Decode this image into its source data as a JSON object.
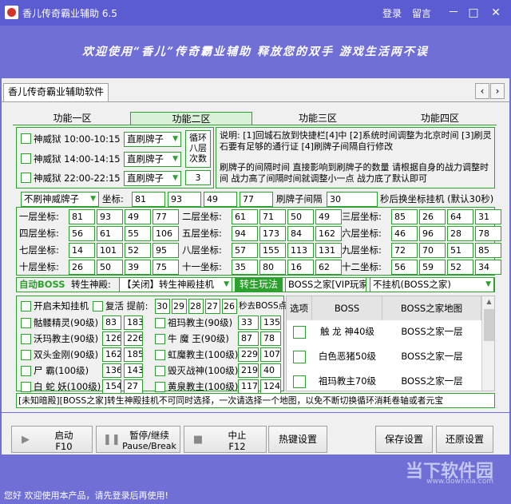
{
  "window": {
    "title": "香儿传奇霸业辅助 6.5",
    "login": "登录",
    "message": "留言",
    "minimize_glyph": "－",
    "restore_glyph": "□",
    "close_glyph": "✕"
  },
  "banner": {
    "slogan": "欢迎使用“香儿”传奇霸业辅助 释放您的双手 游戏生活两不误"
  },
  "main_tab": {
    "label": "香儿传奇霸业辅助软件",
    "prev": "‹",
    "next": "›"
  },
  "tabs": [
    "功能一区",
    "功能二区",
    "功能三区",
    "功能四区"
  ],
  "prison": {
    "rows": [
      {
        "label": "神威狱 10:00-10:15",
        "mode": "直刷牌子"
      },
      {
        "label": "神威狱 14:00-14:15",
        "mode": "直刷牌子"
      },
      {
        "label": "神威狱 22:00-22:15",
        "mode": "直刷牌子"
      }
    ],
    "loop_label": "循环八层次数",
    "loop_count": "3"
  },
  "notes": {
    "text1": "说明: [1]回城石放到快捷栏[4]中 [2]系统时间调整为北京时间 [3]刷灵石要有足够的通行证 [4]刷牌子间隔自行修改",
    "text2": "刷牌子的间隔时间 直接影响到刷牌子的数量 请根据自身的战力调整时间 战力高了间隔时间就调整小一点 战力底了默认即可"
  },
  "coord_row": {
    "token_select": "不刷神威牌子",
    "coord_label": "坐标:",
    "values": [
      "81",
      "93",
      "49",
      "77"
    ],
    "interval_label": "刷牌子间隔",
    "interval": "30",
    "interval_suffix": "秒后换坐标挂机 (默认30秒)"
  },
  "floors": [
    {
      "label": "一层坐标:",
      "v": [
        "81",
        "93",
        "49",
        "77"
      ]
    },
    {
      "label": "二层坐标:",
      "v": [
        "61",
        "71",
        "50",
        "49"
      ]
    },
    {
      "label": "三层坐标:",
      "v": [
        "85",
        "26",
        "64",
        "31"
      ]
    },
    {
      "label": "四层坐标:",
      "v": [
        "56",
        "61",
        "55",
        "106"
      ]
    },
    {
      "label": "五层坐标:",
      "v": [
        "94",
        "173",
        "84",
        "162"
      ]
    },
    {
      "label": "六层坐标:",
      "v": [
        "46",
        "96",
        "28",
        "78"
      ]
    },
    {
      "label": "七层坐标:",
      "v": [
        "14",
        "101",
        "52",
        "95"
      ]
    },
    {
      "label": "八层坐标:",
      "v": [
        "57",
        "155",
        "113",
        "131"
      ]
    },
    {
      "label": "九层坐标:",
      "v": [
        "72",
        "70",
        "51",
        "85"
      ]
    },
    {
      "label": "十层坐标:",
      "v": [
        "26",
        "50",
        "39",
        "75"
      ]
    },
    {
      "label": "十一坐标:",
      "v": [
        "35",
        "80",
        "16",
        "62"
      ]
    },
    {
      "label": "十二坐标:",
      "v": [
        "56",
        "59",
        "52",
        "34"
      ]
    }
  ],
  "boss_bar": {
    "title": "自动BOSS",
    "rebirth_label": "转生神殿:",
    "rebirth_select": "【关闭】转生神殿挂机",
    "play_btn": "转生玩法",
    "home_select": "BOSS之家[VIP玩家]",
    "hang_select": "不挂机(BOSS之家)"
  },
  "boss_left": {
    "unknown_label": "开启未知挂机",
    "revive_label": "复活 提前:",
    "times": [
      "30",
      "29",
      "28",
      "27",
      "26"
    ],
    "times_suffix": "秒去BOSS点",
    "rows": [
      {
        "a": "骷髅精灵(90级)",
        "a1": "83",
        "a2": "183",
        "b": "祖玛教主(90级)",
        "b1": "33",
        "b2": "135"
      },
      {
        "a": "沃玛教主(90级)",
        "a1": "126",
        "a2": "226",
        "b": "牛 魔 王(90级)",
        "b1": "87",
        "b2": "78"
      },
      {
        "a": "双头金刚(90级)",
        "a1": "162",
        "a2": "185",
        "b": "虹魔教主(100级)",
        "b1": "229",
        "b2": "107"
      },
      {
        "a": "尸 霸(100级)",
        "a1": "136",
        "a2": "143",
        "b": "毁灭战神(100级)",
        "b1": "219",
        "b2": "40"
      },
      {
        "a": "白 蛇 妖(100级)",
        "a1": "154",
        "a2": "27",
        "b": "黄泉教主(100级)",
        "b1": "117",
        "b2": "124"
      }
    ]
  },
  "boss_table": {
    "headers": [
      "选项",
      "BOSS",
      "BOSS之家地图"
    ],
    "rows": [
      {
        "boss": "触 龙 神40级",
        "map": "BOSS之家一层"
      },
      {
        "boss": "白色恶猪50级",
        "map": "BOSS之家一层"
      },
      {
        "boss": "祖玛教主70级",
        "map": "BOSS之家一层"
      }
    ]
  },
  "warning": "[未知暗殿][BOSS之家]转生神殿挂机不可同时选择，一次请选择一个地图，以免不断切换循环消耗卷轴或者元宝",
  "buttons": {
    "start": "启动",
    "start_key": "F10",
    "pause": "暂停/继续",
    "pause_key": "Pause/Break",
    "stop": "中止",
    "stop_key": "F12",
    "hotkey": "热键设置",
    "save": "保存设置",
    "restore": "还原设置"
  },
  "status": {
    "text": "您好 欢迎使用本产品，请先登录后再使用!"
  },
  "watermark": {
    "line1": "当下软件园",
    "line2": "www.downxia.com"
  }
}
